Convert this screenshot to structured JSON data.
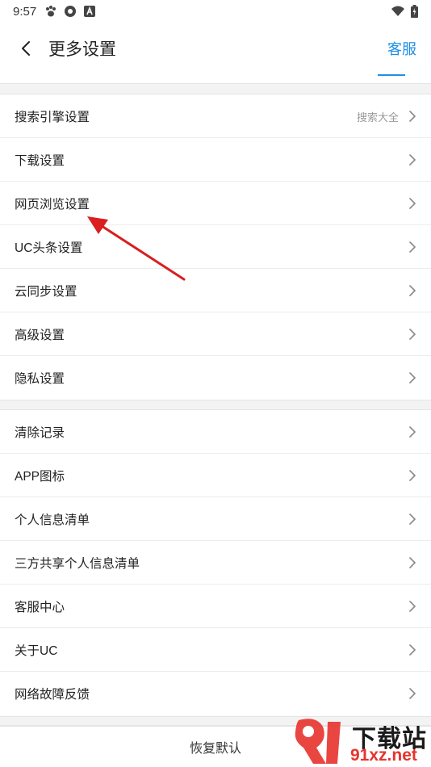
{
  "status_bar": {
    "time": "9:57",
    "left_icons": [
      "paw-icon",
      "aperture-icon",
      "a-letter-icon"
    ],
    "right_icons": [
      "wifi-icon",
      "battery-icon"
    ]
  },
  "header": {
    "title": "更多设置",
    "action_label": "客服"
  },
  "group1": [
    {
      "label": "搜索引擎设置",
      "value": "搜索大全"
    },
    {
      "label": "下载设置"
    },
    {
      "label": "网页浏览设置"
    },
    {
      "label": "UC头条设置"
    },
    {
      "label": "云同步设置"
    },
    {
      "label": "高级设置"
    },
    {
      "label": "隐私设置"
    }
  ],
  "group2": [
    {
      "label": "清除记录"
    },
    {
      "label": "APP图标"
    },
    {
      "label": "个人信息清单"
    },
    {
      "label": "三方共享个人信息清单"
    },
    {
      "label": "客服中心"
    },
    {
      "label": "关于UC"
    },
    {
      "label": "网络故障反馈"
    }
  ],
  "footer": {
    "reset_label": "恢复默认"
  },
  "watermark": {
    "logo_text": "下载站",
    "url": "91xz.net"
  },
  "colors": {
    "accent": "#1f8fe5",
    "annotation_arrow": "#d91f1f",
    "watermark_red": "#e8322c"
  }
}
